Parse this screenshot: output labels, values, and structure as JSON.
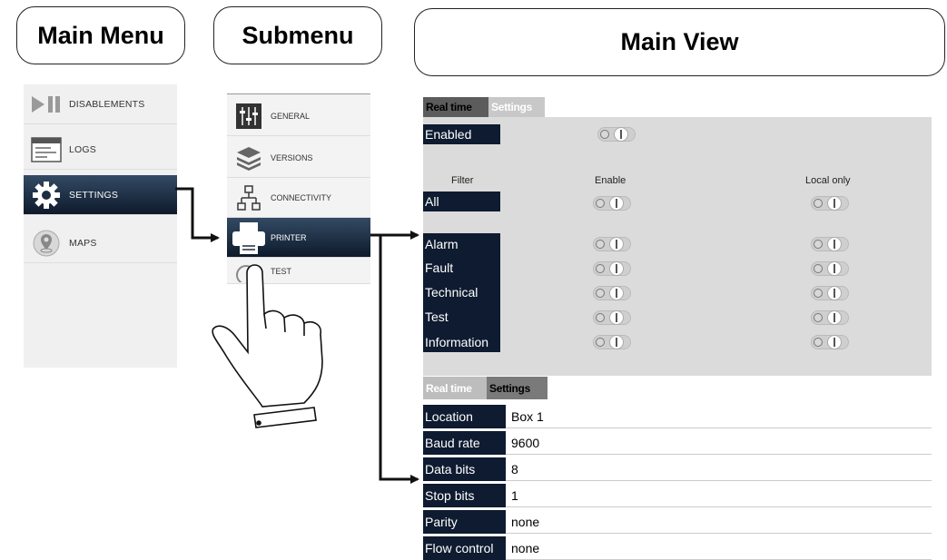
{
  "headers": {
    "main_menu": "Main Menu",
    "submenu": "Submenu",
    "main_view": "Main View"
  },
  "main_menu": {
    "items": [
      {
        "label": "DISABLEMENTS",
        "icon": "play-pause-icon"
      },
      {
        "label": "LOGS",
        "icon": "window-log-icon"
      },
      {
        "label": "SETTINGS",
        "icon": "gear-icon",
        "active": true
      },
      {
        "label": "MAPS",
        "icon": "map-pin-icon"
      }
    ]
  },
  "submenu": {
    "items": [
      {
        "label": "GENERAL",
        "icon": "sliders-icon"
      },
      {
        "label": "VERSIONS",
        "icon": "layers-icon"
      },
      {
        "label": "CONNECTIVITY",
        "icon": "network-icon"
      },
      {
        "label": "PRINTER",
        "icon": "printer-icon",
        "active": true
      },
      {
        "label": "TEST",
        "icon": "test-icon"
      }
    ]
  },
  "realtime_panel": {
    "tabs": {
      "realtime": "Real time",
      "settings": "Settings"
    },
    "enabled_label": "Enabled",
    "columns": {
      "filter": "Filter",
      "enable": "Enable",
      "local_only": "Local only"
    },
    "all_label": "All",
    "filters": [
      "Alarm",
      "Fault",
      "Technical",
      "Test",
      "Information"
    ]
  },
  "settings_panel": {
    "tabs": {
      "realtime": "Real time",
      "settings": "Settings"
    },
    "rows": [
      {
        "label": "Location",
        "value": "Box 1"
      },
      {
        "label": "Baud rate",
        "value": "9600"
      },
      {
        "label": "Data bits",
        "value": "8"
      },
      {
        "label": "Stop bits",
        "value": "1"
      },
      {
        "label": "Parity",
        "value": "none"
      },
      {
        "label": "Flow control",
        "value": "none"
      }
    ]
  },
  "colors": {
    "active_bg": "#0e1a2b",
    "label_bg": "#0e1b30",
    "panel_bg": "#dcdbdb"
  }
}
